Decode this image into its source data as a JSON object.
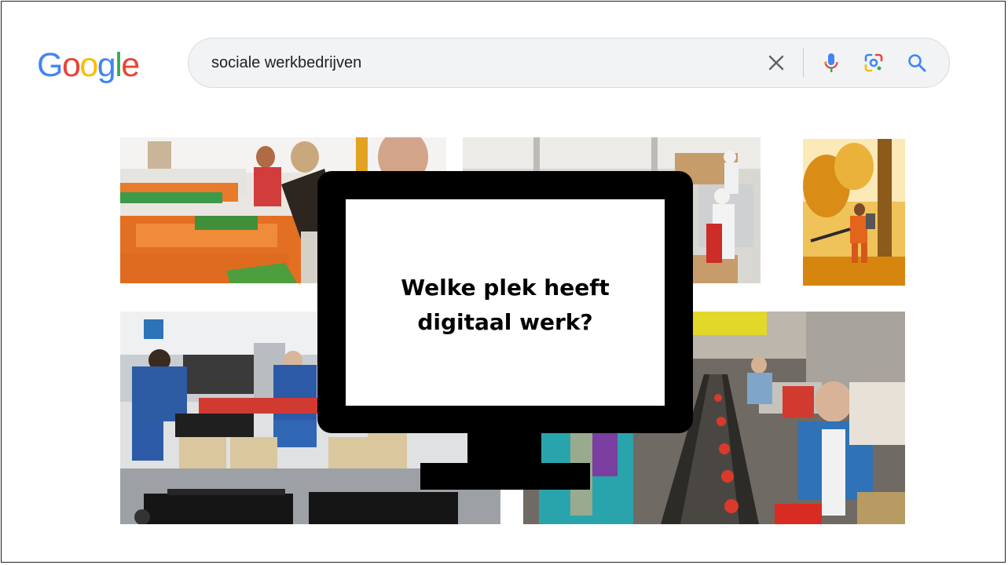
{
  "logo": {
    "letters": [
      "G",
      "o",
      "o",
      "g",
      "l",
      "e"
    ],
    "colors": [
      "#4285F4",
      "#EA4335",
      "#FBBC05",
      "#4285F4",
      "#34A853",
      "#EA4335"
    ]
  },
  "search": {
    "query": "sociale werkbedrijven",
    "icons": [
      "close-icon",
      "microphone-icon",
      "lens-icon",
      "search-icon"
    ]
  },
  "images": [
    {
      "name": "sorting-workers-photo",
      "dominant_color": "#e8772a"
    },
    {
      "name": "factory-hygiene-workers-photo",
      "dominant_color": "#d7d5cf"
    },
    {
      "name": "autumn-leafblower-photo",
      "dominant_color": "#e6a21c"
    },
    {
      "name": "crate-packing-workers-photo",
      "dominant_color": "#2b4f86"
    },
    {
      "name": "conveyor-belt-workers-photo",
      "dominant_color": "#3f3b36"
    }
  ],
  "overlay": {
    "question": "Welke plek heeft\ndigitaal werk?"
  }
}
